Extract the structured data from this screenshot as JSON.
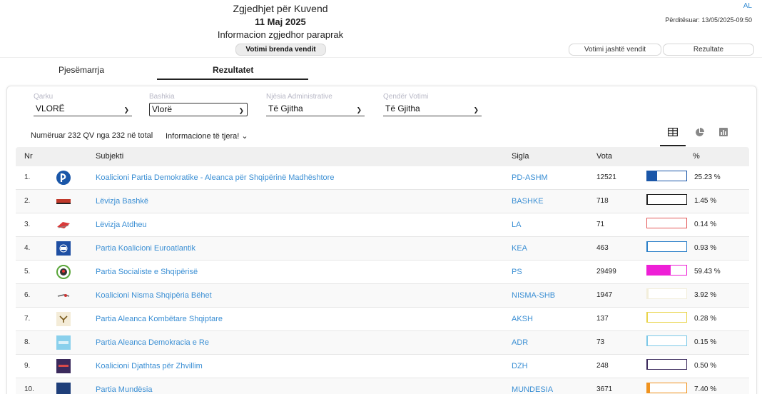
{
  "header": {
    "title": "Zgjedhjet për Kuvend",
    "date": "11 Maj 2025",
    "subtitle": "Informacion zgjedhor paraprak",
    "lang": "AL",
    "updated": "Përditësuar: 13/05/2025-09:50",
    "btn_inside": "Votimi brenda vendit",
    "btn_abroad": "Votimi jashtë vendit",
    "btn_results": "Rezultate"
  },
  "tabs": {
    "participation": "Pjesëmarrja",
    "results": "Rezultatet"
  },
  "filters": [
    {
      "label": "Qarku",
      "value": "VLORË"
    },
    {
      "label": "Bashkia",
      "value": "Vlorë"
    },
    {
      "label": "Njësia Administrative",
      "value": "Të Gjitha"
    },
    {
      "label": "Qendër Votimi",
      "value": "Të Gjitha"
    }
  ],
  "meta": {
    "counted": "Numëruar 232 QV nga 232 në total",
    "more_info": "Informacione të tjera! ⌄"
  },
  "view_icons": [
    "table-icon",
    "pie-chart-icon",
    "bar-chart-icon"
  ],
  "table": {
    "headers": {
      "nr": "Nr",
      "subject": "Subjekti",
      "sigla": "Sigla",
      "vota": "Vota",
      "pct": "%"
    },
    "rows": [
      {
        "nr": "1.",
        "name": "Koalicioni Partia Demokratike - Aleanca për Shqipërinë Madhështore",
        "sigla": "PD-ASHM",
        "vota": "12521",
        "pct": "25.23 %",
        "share": 25.23,
        "color": "#1a56a8",
        "logo": "pd-logo"
      },
      {
        "nr": "2.",
        "name": "Lëvizja Bashkë",
        "sigla": "BASHKE",
        "vota": "718",
        "pct": "1.45 %",
        "share": 1.45,
        "color": "#222222",
        "logo": "bashke-logo"
      },
      {
        "nr": "3.",
        "name": "Lëvizja Atdheu",
        "sigla": "LA",
        "vota": "71",
        "pct": "0.14 %",
        "share": 0.14,
        "color": "#e35a5a",
        "logo": "la-logo"
      },
      {
        "nr": "4.",
        "name": "Partia Koalicioni Euroatlantik",
        "sigla": "KEA",
        "vota": "463",
        "pct": "0.93 %",
        "share": 0.93,
        "color": "#2b7fc8",
        "logo": "kea-logo"
      },
      {
        "nr": "5.",
        "name": "Partia Socialiste e Shqipërisë",
        "sigla": "PS",
        "vota": "29499",
        "pct": "59.43 %",
        "share": 59.43,
        "color": "#ee1fd6",
        "logo": "ps-logo"
      },
      {
        "nr": "6.",
        "name": "Koalicioni Nisma Shqipëria Bëhet",
        "sigla": "NISMA-SHB",
        "vota": "1947",
        "pct": "3.92 %",
        "share": 3.92,
        "color": "#f2eedb",
        "logo": "nisma-logo"
      },
      {
        "nr": "7.",
        "name": "Partia Aleanca Kombëtare Shqiptare",
        "sigla": "AKSH",
        "vota": "137",
        "pct": "0.28 %",
        "share": 0.28,
        "color": "#e9d44a",
        "logo": "aksh-logo"
      },
      {
        "nr": "8.",
        "name": "Partia Aleanca Demokracia e Re",
        "sigla": "ADR",
        "vota": "73",
        "pct": "0.15 %",
        "share": 0.15,
        "color": "#7cc8e8",
        "logo": "adr-logo"
      },
      {
        "nr": "9.",
        "name": "Koalicioni Djathtas për Zhvillim",
        "sigla": "DZH",
        "vota": "248",
        "pct": "0.50 %",
        "share": 0.5,
        "color": "#3b2a5c",
        "logo": "dzh-logo"
      },
      {
        "nr": "10.",
        "name": "Partia Mundësia",
        "sigla": "MUNDESIA",
        "vota": "3671",
        "pct": "7.40 %",
        "share": 7.4,
        "color": "#f0931f",
        "logo": "mundesia-logo"
      }
    ]
  }
}
